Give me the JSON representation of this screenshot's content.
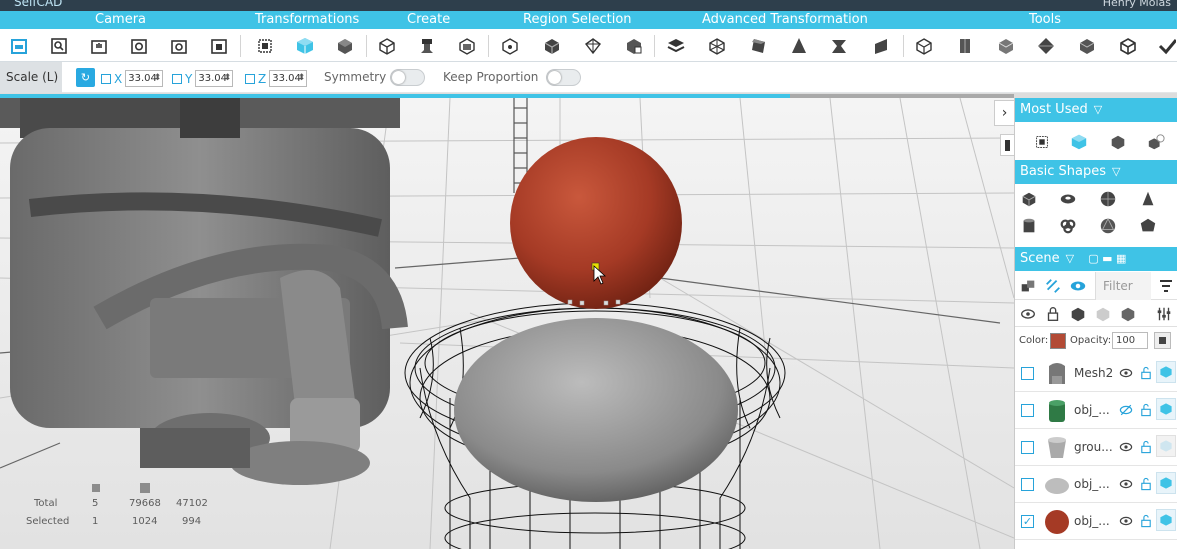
{
  "app": {
    "logo_text": "SelfCAD",
    "right_text": "Henry Molas"
  },
  "categories": [
    "Camera",
    "Transformations",
    "Create",
    "Region Selection",
    "Advanced Transformation",
    "Tools"
  ],
  "options": {
    "mode_label": "Scale (L)",
    "x_label": "X",
    "x_value": "33.04",
    "y_label": "Y",
    "y_value": "33.04",
    "z_label": "Z",
    "z_value": "33.04",
    "symmetry_label": "Symmetry",
    "keep_proportion_label": "Keep Proportion"
  },
  "stats": {
    "total_label": "Total",
    "selected_label": "Selected",
    "total": [
      "5",
      "79668",
      "47102"
    ],
    "selected": [
      "1",
      "1024",
      "994"
    ]
  },
  "panel": {
    "most_used_title": "Most Used",
    "basic_shapes_title": "Basic Shapes",
    "scene_title": "Scene",
    "filter_placeholder": "Filter",
    "color_label": "Color:",
    "opacity_label": "Opacity:",
    "opacity_value": "100",
    "color_value": "#b24a35"
  },
  "scene_items": [
    {
      "name": "Mesh2",
      "checked": false,
      "thumb": "figure"
    },
    {
      "name": "obj_...",
      "checked": false,
      "thumb": "cylinder-green"
    },
    {
      "name": "grou...",
      "checked": false,
      "thumb": "cup"
    },
    {
      "name": "obj_...",
      "checked": false,
      "thumb": "ellipsoid"
    },
    {
      "name": "obj_...",
      "checked": true,
      "thumb": "sphere-red"
    }
  ],
  "colors": {
    "accent": "#3fc3e6",
    "sphere": "#b0412b"
  }
}
